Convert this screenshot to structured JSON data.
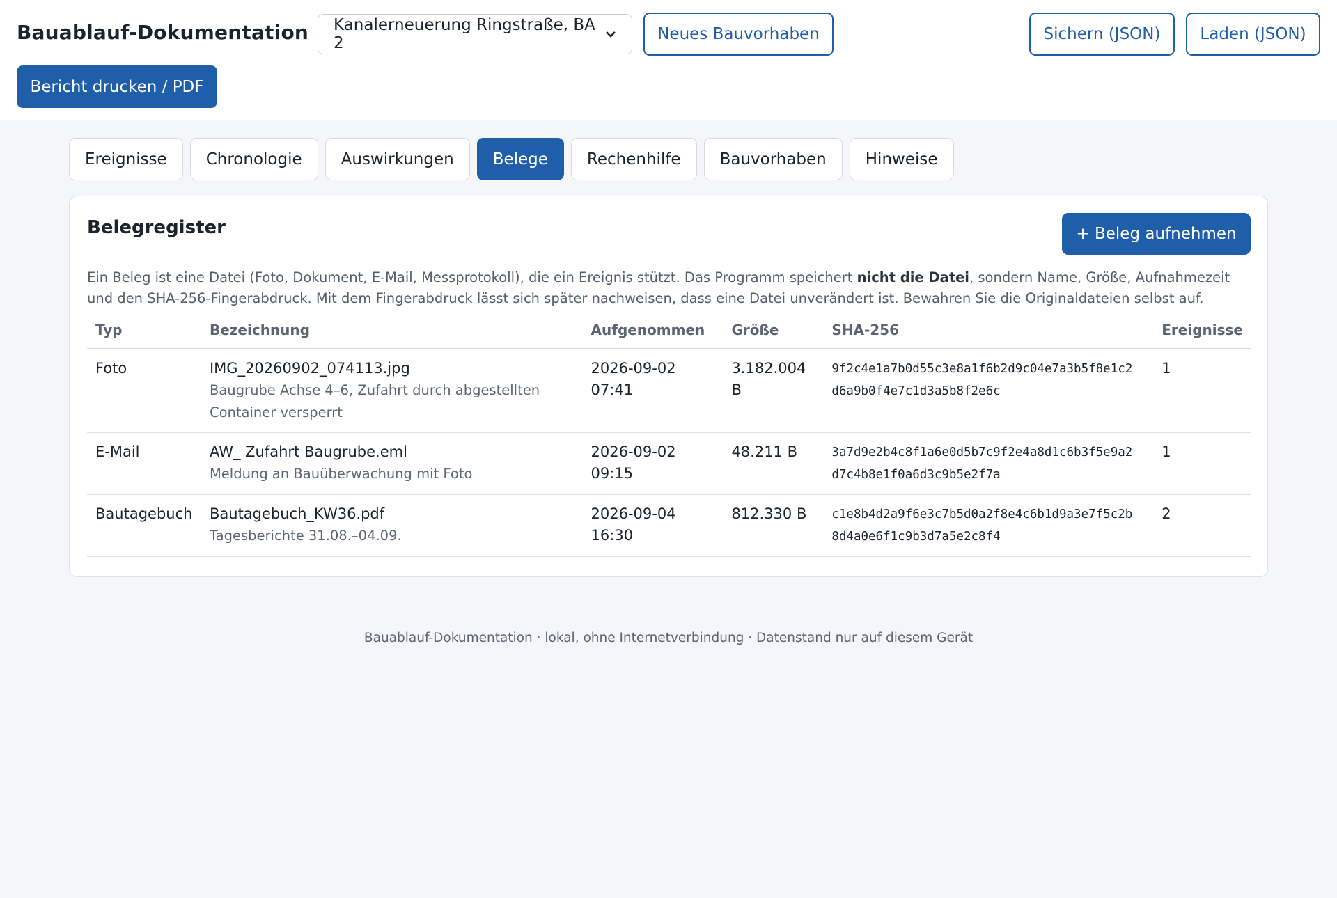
{
  "header": {
    "title": "Bauablauf-Dokumentation",
    "project_select_value": "Kanalerneuerung Ringstraße, BA 2",
    "new_project_label": "Neues Bauvorhaben",
    "save_label": "Sichern (JSON)",
    "load_label": "Laden (JSON)",
    "print_label": "Bericht drucken / PDF"
  },
  "tabs": [
    {
      "label": "Ereignisse"
    },
    {
      "label": "Chronologie"
    },
    {
      "label": "Auswirkungen"
    },
    {
      "label": "Belege",
      "active": true
    },
    {
      "label": "Rechenhilfe"
    },
    {
      "label": "Bauvorhaben"
    },
    {
      "label": "Hinweise"
    }
  ],
  "register": {
    "title": "Belegregister",
    "add_label": "+ Beleg aufnehmen",
    "intro_before": "Ein Beleg ist eine Datei (Foto, Dokument, E-Mail, Messprotokoll), die ein Ereignis stützt. Das Programm speichert ",
    "intro_bold": "nicht die Datei",
    "intro_after": ", sondern Name, Größe, Aufnahmezeit und den SHA-256-Fingerabdruck. Mit dem Fingerabdruck lässt sich später nachweisen, dass eine Datei unverändert ist. Bewahren Sie die Originaldateien selbst auf.",
    "columns": [
      "Typ",
      "Bezeichnung",
      "Aufgenommen",
      "Größe",
      "SHA-256",
      "Ereignisse"
    ],
    "rows": [
      {
        "typ": "Foto",
        "name": "IMG_20260902_074113.jpg",
        "desc_1": "Baugrube Achse 4–6, Zufahrt durch abgestellten",
        "desc_2": "Container versperrt",
        "date": "2026-09-02",
        "time": "07:41",
        "size_1": "3.182.004",
        "size_2": "B",
        "hash_1": "9f2c4e1a7b0d55c3e8a1f6b2d9c04e7a3b5f8e1c2",
        "hash_2": "d6a9b0f4e7c1d3a5b8f2e6c",
        "events": "1"
      },
      {
        "typ": "E-Mail",
        "name": "AW_ Zufahrt Baugrube.eml",
        "desc_1": "Meldung an Bauüberwachung mit Foto",
        "desc_2": "",
        "date": "2026-09-02",
        "time": "09:15",
        "size_1": "48.211 B",
        "size_2": "",
        "hash_1": "3a7d9e2b4c8f1a6e0d5b7c9f2e4a8d1c6b3f5e9a2",
        "hash_2": "d7c4b8e1f0a6d3c9b5e2f7a",
        "events": "1"
      },
      {
        "typ": "Bautagebuch",
        "name": "Bautagebuch_KW36.pdf",
        "desc_1": "Tagesberichte 31.08.–04.09.",
        "desc_2": "",
        "date": "2026-09-04",
        "time": "16:30",
        "size_1": "812.330 B",
        "size_2": "",
        "hash_1": "c1e8b4d2a9f6e3c7b5d0a2f8e4c6b1d9a3e7f5c2b",
        "hash_2": "8d4a0e6f1c9b3d7a5e2c8f4",
        "events": "2"
      }
    ]
  },
  "footer": "Bauablauf-Dokumentation · lokal, ohne Internetverbindung · Datenstand nur auf diesem Gerät",
  "colors": {
    "accent": "#1f5ea8",
    "background": "#f5f6f9"
  }
}
